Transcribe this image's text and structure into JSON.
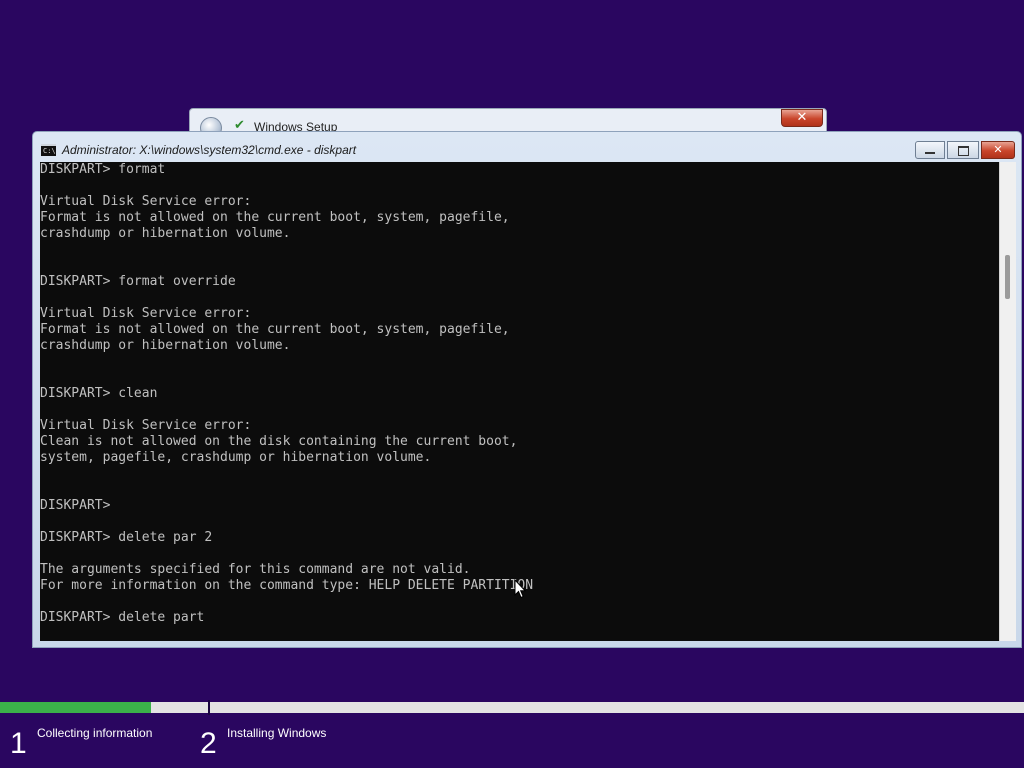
{
  "theme": {
    "background": "#2a0660",
    "progress_green": "#3bb04a"
  },
  "setup_window": {
    "title": "Windows Setup",
    "close_label": "✕"
  },
  "cmd_window": {
    "title": "Administrator: X:\\windows\\system32\\cmd.exe - diskpart",
    "icon_glyph": "C:\\",
    "close_label": "✕"
  },
  "console": {
    "lines": [
      "DISKPART> format",
      "",
      "Virtual Disk Service error:",
      "Format is not allowed on the current boot, system, pagefile,",
      "crashdump or hibernation volume.",
      "",
      "",
      "DISKPART> format override",
      "",
      "Virtual Disk Service error:",
      "Format is not allowed on the current boot, system, pagefile,",
      "crashdump or hibernation volume.",
      "",
      "",
      "DISKPART> clean",
      "",
      "Virtual Disk Service error:",
      "Clean is not allowed on the disk containing the current boot,",
      "system, pagefile, crashdump or hibernation volume.",
      "",
      "",
      "DISKPART>",
      "",
      "DISKPART> delete par 2",
      "",
      "The arguments specified for this command are not valid.",
      "For more information on the command type: HELP DELETE PARTITION",
      "",
      "DISKPART> delete part"
    ]
  },
  "setup_progress": {
    "fill_fraction": 0.147,
    "steps": [
      {
        "number": "1",
        "label": "Collecting information"
      },
      {
        "number": "2",
        "label": "Installing Windows"
      }
    ]
  }
}
